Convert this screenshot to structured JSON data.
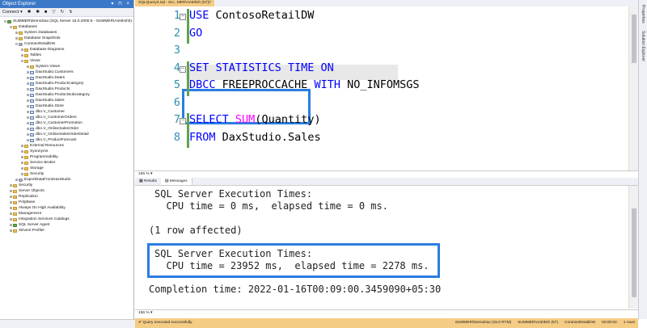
{
  "object_explorer": {
    "title": "Object Explorer",
    "toolbar": [
      "Connect ▾",
      "✱",
      "✱",
      "■",
      "▽",
      "↻",
      "↯"
    ],
    "tree": [
      {
        "indent": 0,
        "exp": "⊟",
        "icon": "srv",
        "label": "SUMMER\\DemoDax (SQL Server 15.0.2000.5 - SUMMER\\Antrikshh)"
      },
      {
        "indent": 1,
        "exp": "⊟",
        "icon": "folder",
        "label": "Databases"
      },
      {
        "indent": 2,
        "exp": "⊞",
        "icon": "folder",
        "label": "System Databases"
      },
      {
        "indent": 2,
        "exp": "⊞",
        "icon": "folder",
        "label": "Database Snapshots"
      },
      {
        "indent": 2,
        "exp": "⊟",
        "icon": "db",
        "label": "ContosoRetailDW"
      },
      {
        "indent": 3,
        "exp": "⊞",
        "icon": "folder",
        "label": "Database Diagrams"
      },
      {
        "indent": 3,
        "exp": "⊞",
        "icon": "folder",
        "label": "Tables"
      },
      {
        "indent": 3,
        "exp": "⊟",
        "icon": "folder",
        "label": "Views"
      },
      {
        "indent": 4,
        "exp": "⊞",
        "icon": "folder",
        "label": "System Views"
      },
      {
        "indent": 4,
        "exp": "⊞",
        "icon": "tbl",
        "label": "DaxStudio.Customers"
      },
      {
        "indent": 4,
        "exp": "⊞",
        "icon": "tbl",
        "label": "DaxStudio.Dates"
      },
      {
        "indent": 4,
        "exp": "⊞",
        "icon": "tbl",
        "label": "DaxStudio.ProductCategory"
      },
      {
        "indent": 4,
        "exp": "⊞",
        "icon": "tbl",
        "label": "DaxStudio.Products"
      },
      {
        "indent": 4,
        "exp": "⊞",
        "icon": "tbl",
        "label": "DaxStudio.ProductSubcategory"
      },
      {
        "indent": 4,
        "exp": "⊞",
        "icon": "tbl",
        "label": "DaxStudio.Sales"
      },
      {
        "indent": 4,
        "exp": "⊞",
        "icon": "tbl",
        "label": "DaxStudio.Store"
      },
      {
        "indent": 4,
        "exp": "⊞",
        "icon": "tbl",
        "label": "dbo.V_Customer"
      },
      {
        "indent": 4,
        "exp": "⊞",
        "icon": "tbl",
        "label": "dbo.V_CustomerOrders"
      },
      {
        "indent": 4,
        "exp": "⊞",
        "icon": "tbl",
        "label": "dbo.V_CustomerPromotion"
      },
      {
        "indent": 4,
        "exp": "⊞",
        "icon": "tbl",
        "label": "dbo.V_OnlineSalesOrder"
      },
      {
        "indent": 4,
        "exp": "⊞",
        "icon": "tbl",
        "label": "dbo.V_OnlineSalesOrderDetail"
      },
      {
        "indent": 4,
        "exp": "⊞",
        "icon": "tbl",
        "label": "dbo.V_ProductForecast"
      },
      {
        "indent": 3,
        "exp": "⊞",
        "icon": "folder",
        "label": "External Resources"
      },
      {
        "indent": 3,
        "exp": "⊞",
        "icon": "folder",
        "label": "Synonyms"
      },
      {
        "indent": 3,
        "exp": "⊞",
        "icon": "folder",
        "label": "Programmability"
      },
      {
        "indent": 3,
        "exp": "⊞",
        "icon": "folder",
        "label": "Service Broker"
      },
      {
        "indent": 3,
        "exp": "⊞",
        "icon": "folder",
        "label": "Storage"
      },
      {
        "indent": 3,
        "exp": "⊞",
        "icon": "folder",
        "label": "Security"
      },
      {
        "indent": 2,
        "exp": "⊞",
        "icon": "db",
        "label": "ExportDataFromDaxStudio"
      },
      {
        "indent": 1,
        "exp": "⊞",
        "icon": "folder",
        "label": "Security"
      },
      {
        "indent": 1,
        "exp": "⊞",
        "icon": "folder",
        "label": "Server Objects"
      },
      {
        "indent": 1,
        "exp": "⊞",
        "icon": "folder",
        "label": "Replication"
      },
      {
        "indent": 1,
        "exp": "⊞",
        "icon": "folder",
        "label": "PolyBase"
      },
      {
        "indent": 1,
        "exp": "⊞",
        "icon": "folder",
        "label": "Always On High Availability"
      },
      {
        "indent": 1,
        "exp": "⊞",
        "icon": "folder",
        "label": "Management"
      },
      {
        "indent": 1,
        "exp": "⊞",
        "icon": "folder",
        "label": "Integration Services Catalogs"
      },
      {
        "indent": 1,
        "exp": "⊞",
        "icon": "srv",
        "label": "SQL Server Agent"
      },
      {
        "indent": 1,
        "exp": "⊞",
        "icon": "folder",
        "label": "XEvent Profiler"
      }
    ]
  },
  "doc_tab": "SQLQuery3.sql - SU...MER\\Antriksh (57))*",
  "rail": {
    "properties": "Properties",
    "solution_explorer": "Solution Explorer"
  },
  "editor": {
    "line_numbers": [
      "1",
      "2",
      "3",
      "4",
      "5",
      "6",
      "7",
      "8"
    ],
    "lines": [
      [
        {
          "t": "USE ",
          "c": "kw"
        },
        {
          "t": "ContosoRetailDW",
          "c": ""
        }
      ],
      [
        {
          "t": "GO",
          "c": "kw"
        }
      ],
      [],
      [
        {
          "t": "SET STATISTICS TIME ON",
          "c": "kw"
        }
      ],
      [
        {
          "t": "DBCC ",
          "c": "kw"
        },
        {
          "t": "FREEPROCCACHE ",
          "c": ""
        },
        {
          "t": "WITH ",
          "c": "kw"
        },
        {
          "t": "NO_INFOMSGS",
          "c": ""
        }
      ],
      [],
      [
        {
          "t": "SELECT ",
          "c": "kw"
        },
        {
          "t": "SUM",
          "c": "fn"
        },
        {
          "t": "(",
          "c": ""
        },
        {
          "t": "Quantity",
          "c": ""
        },
        {
          "t": ")",
          "c": ""
        }
      ],
      [
        {
          "t": "FROM ",
          "c": "kw"
        },
        {
          "t": "DaxStudio",
          "c": ""
        },
        {
          "t": ".",
          "c": ""
        },
        {
          "t": "Sales",
          "c": ""
        }
      ]
    ]
  },
  "zoom": "156 %",
  "zoom2": "156 %",
  "results_tabs": {
    "results": "Results",
    "messages": "Messages"
  },
  "messages": {
    "line1": "SQL Server Execution Times:",
    "line2": "  CPU time = 0 ms,  elapsed time = 0 ms.",
    "line3": "(1 row affected)",
    "line4": "SQL Server Execution Times:",
    "line5": "  CPU time = 23952 ms,  elapsed time = 2278 ms.",
    "line6": "Completion time: 2022-01-16T00:09:00.3459090+05:30"
  },
  "status": {
    "message": "Query executed successfully.",
    "items": [
      "SUMMER\\DemoDax (15.0 RTM)",
      "SUMMER\\Antriksh (57)",
      "ContosoRetailDW",
      "00:00:02",
      "1 rows"
    ]
  }
}
